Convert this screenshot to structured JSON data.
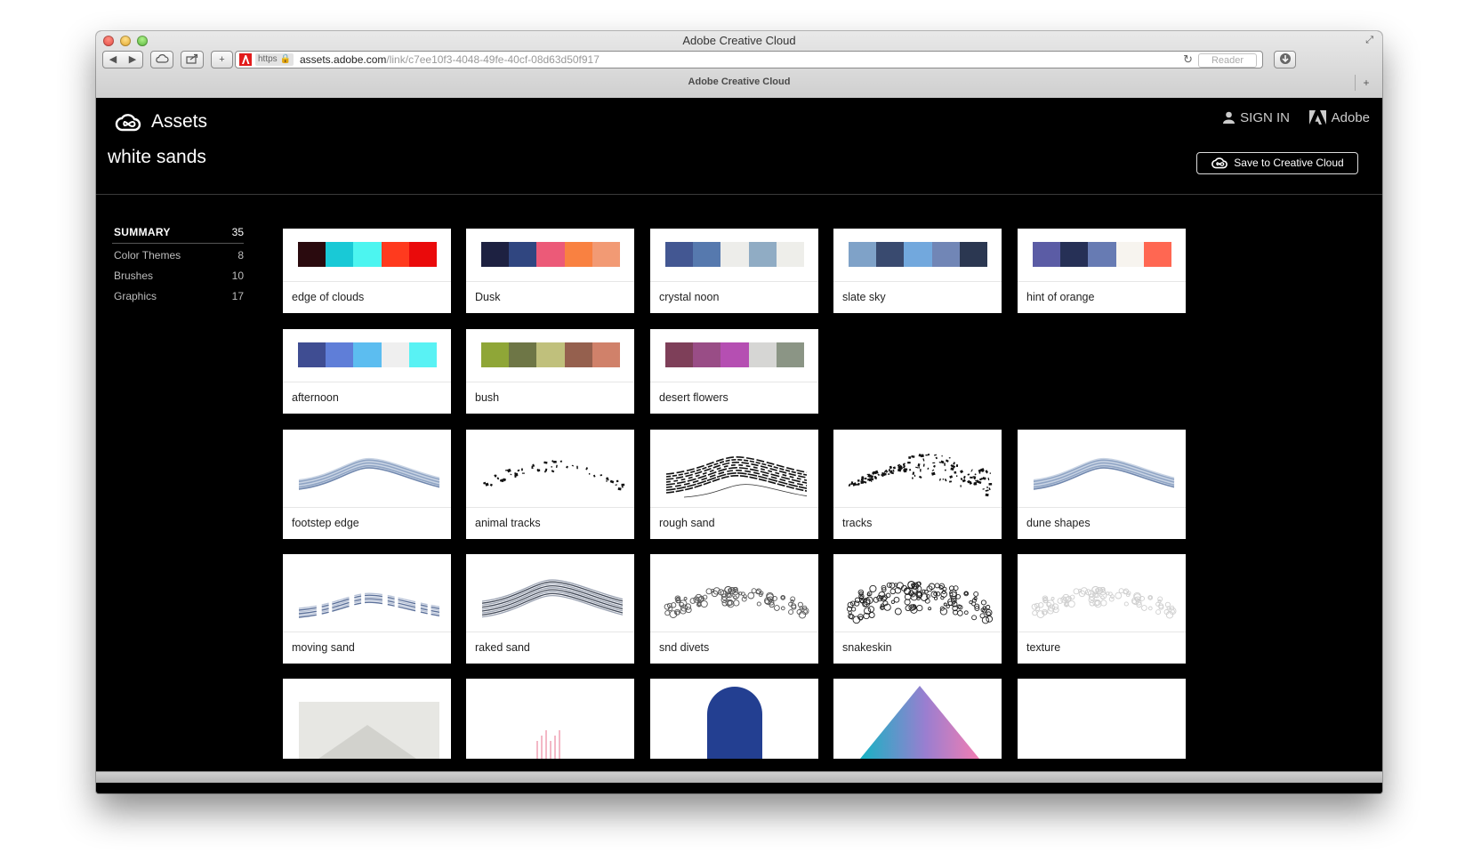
{
  "browser": {
    "window_title": "Adobe Creative Cloud",
    "url_scheme": "https",
    "url_host": "assets.adobe.com",
    "url_path": "/link/c7ee10f3-4048-49fe-40cf-08d63d50f917",
    "reader_label": "Reader",
    "tab_title": "Adobe Creative Cloud"
  },
  "header": {
    "brand": "Assets",
    "signin": "SIGN IN",
    "adobe": "Adobe",
    "page_title": "white sands",
    "save_button": "Save to Creative Cloud"
  },
  "sidebar": {
    "items": [
      {
        "label": "SUMMARY",
        "count": "35"
      },
      {
        "label": "Color Themes",
        "count": "8"
      },
      {
        "label": "Brushes",
        "count": "10"
      },
      {
        "label": "Graphics",
        "count": "17"
      }
    ]
  },
  "color_themes": [
    {
      "name": "edge of clouds",
      "colors": [
        "#2a0a0e",
        "#19c9d6",
        "#4cf5f0",
        "#ff3a1e",
        "#ea0a0b"
      ]
    },
    {
      "name": "Dusk",
      "colors": [
        "#1d2141",
        "#304680",
        "#ec5a78",
        "#f98141",
        "#f29a74"
      ]
    },
    {
      "name": "crystal noon",
      "colors": [
        "#435792",
        "#5679ae",
        "#ededea",
        "#90acc4",
        "#eeeeea"
      ]
    },
    {
      "name": "slate sky",
      "colors": [
        "#7fa2c8",
        "#394a6f",
        "#72a8dd",
        "#7186b6",
        "#2b3751"
      ]
    },
    {
      "name": "hint of orange",
      "colors": [
        "#5b5ca5",
        "#263056",
        "#677bb3",
        "#f7f4ef",
        "#ff6752"
      ]
    },
    {
      "name": "afternoon",
      "colors": [
        "#3f4d92",
        "#5f7ed8",
        "#5cbdf0",
        "#efefef",
        "#59f2f4"
      ]
    },
    {
      "name": "bush",
      "colors": [
        "#8fa637",
        "#6e7646",
        "#c0c07c",
        "#95604e",
        "#d0816a"
      ]
    },
    {
      "name": "desert flowers",
      "colors": [
        "#7e3f59",
        "#994d86",
        "#b54fb2",
        "#d6d6d4",
        "#8b9585"
      ]
    }
  ],
  "brushes": [
    {
      "name": "footstep edge",
      "style": "ribbon-blue"
    },
    {
      "name": "animal tracks",
      "style": "spatter"
    },
    {
      "name": "rough sand",
      "style": "striated"
    },
    {
      "name": "tracks",
      "style": "dense-spatter"
    },
    {
      "name": "dune shapes",
      "style": "ribbon-blue"
    },
    {
      "name": "moving sand",
      "style": "wispy"
    },
    {
      "name": "raked sand",
      "style": "raked"
    },
    {
      "name": "snd divets",
      "style": "divets"
    },
    {
      "name": "snakeskin",
      "style": "snakeskin"
    },
    {
      "name": "texture",
      "style": "faint"
    }
  ],
  "graphics": [
    {
      "style": "photo"
    },
    {
      "style": "pink-lines"
    },
    {
      "style": "blue-arch"
    },
    {
      "style": "gradient-triangle"
    },
    {
      "style": "blank"
    }
  ]
}
